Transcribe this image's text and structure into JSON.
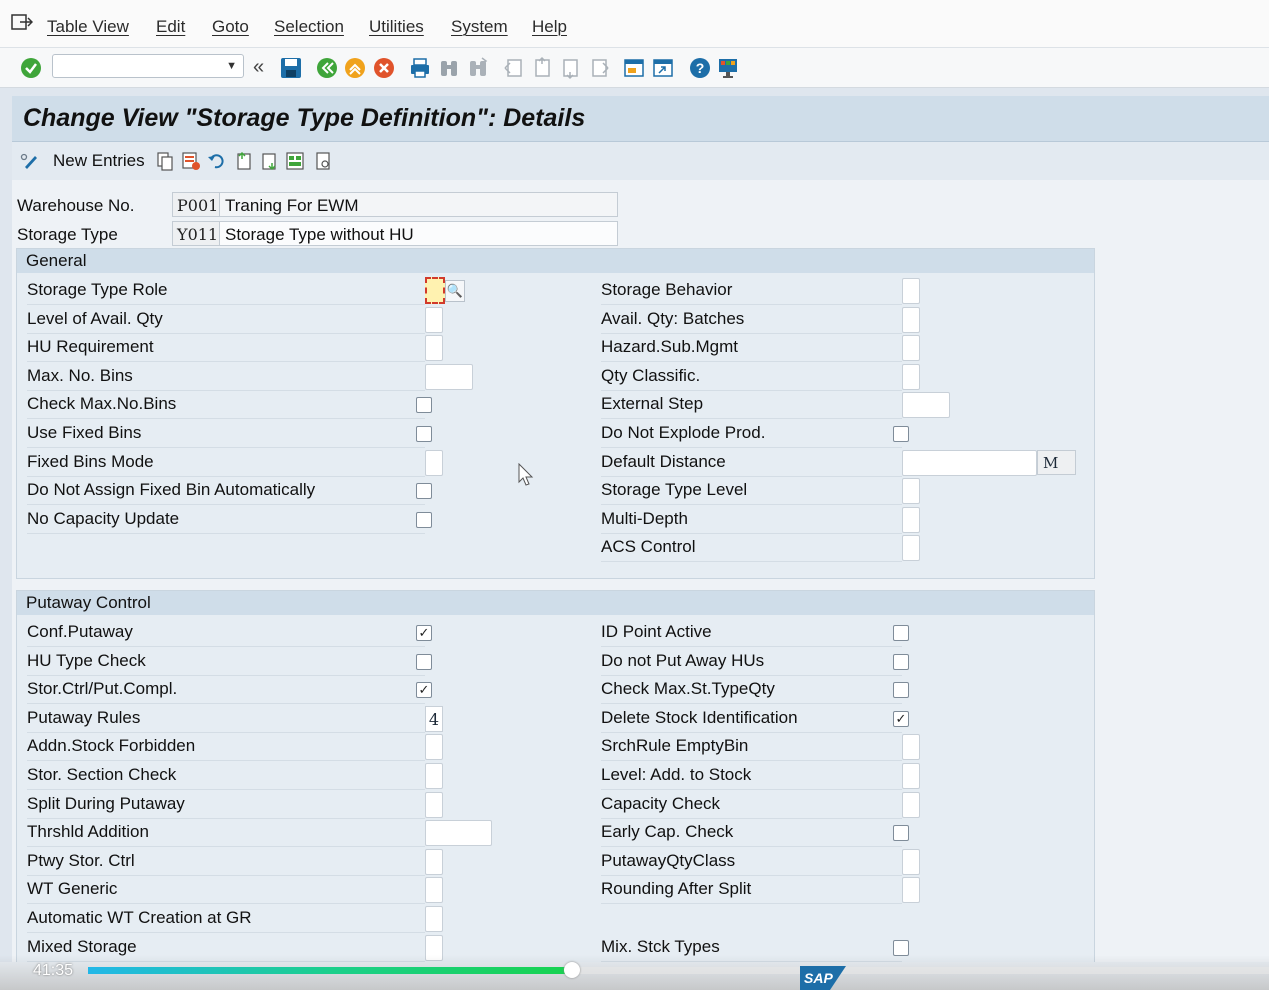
{
  "menubar": {
    "items": [
      "Table View",
      "Edit",
      "Goto",
      "Selection",
      "Utilities",
      "System",
      "Help"
    ]
  },
  "toolbar": {
    "command_field": "",
    "icons": [
      "enter-check-icon",
      "back-chevron-icon",
      "save-icon",
      "back-icon",
      "exit-icon",
      "cancel-icon",
      "print-icon",
      "find-icon",
      "find-next-icon",
      "first-page-icon",
      "previous-page-icon",
      "next-page-icon",
      "last-page-icon",
      "create-session-icon",
      "shortcut-icon",
      "help-icon",
      "customize-layout-icon"
    ]
  },
  "title": "Change View \"Storage Type Definition\": Details",
  "app_toolbar": {
    "new_entries": "New Entries"
  },
  "header": {
    "warehouse_label": "Warehouse No.",
    "warehouse_code": "P001",
    "warehouse_desc": "Traning For EWM",
    "storage_type_label": "Storage Type",
    "storage_type_code": "Y011",
    "storage_type_desc": "Storage Type without HU"
  },
  "general": {
    "title": "General",
    "left": [
      {
        "label": "Storage Type Role",
        "kind": "focus"
      },
      {
        "label": "Level of Avail. Qty",
        "kind": "box"
      },
      {
        "label": "HU Requirement",
        "kind": "box"
      },
      {
        "label": "Max. No. Bins",
        "kind": "wide"
      },
      {
        "label": "Check Max.No.Bins",
        "kind": "check",
        "checked": false
      },
      {
        "label": "Use Fixed Bins",
        "kind": "check",
        "checked": false
      },
      {
        "label": "Fixed Bins Mode",
        "kind": "box"
      },
      {
        "label": "Do Not Assign Fixed Bin Automatically",
        "kind": "check",
        "checked": false
      },
      {
        "label": "No Capacity Update",
        "kind": "check",
        "checked": false
      }
    ],
    "right": [
      {
        "label": "Storage Behavior",
        "kind": "box"
      },
      {
        "label": "Avail. Qty: Batches",
        "kind": "box"
      },
      {
        "label": "Hazard.Sub.Mgmt",
        "kind": "box"
      },
      {
        "label": "Qty Classific.",
        "kind": "box"
      },
      {
        "label": "External Step",
        "kind": "wide"
      },
      {
        "label": "Do Not Explode Prod.",
        "kind": "check",
        "checked": false
      },
      {
        "label": "Default Distance",
        "kind": "distance",
        "unit": "M"
      },
      {
        "label": "Storage Type Level",
        "kind": "box"
      },
      {
        "label": "Multi-Depth",
        "kind": "box"
      },
      {
        "label": "ACS Control",
        "kind": "box"
      }
    ]
  },
  "putaway": {
    "title": "Putaway Control",
    "left": [
      {
        "label": "Conf.Putaway",
        "kind": "check",
        "checked": true
      },
      {
        "label": "HU Type Check",
        "kind": "check",
        "checked": false
      },
      {
        "label": "Stor.Ctrl/Put.Compl.",
        "kind": "check",
        "checked": true
      },
      {
        "label": "Putaway Rules",
        "kind": "num",
        "value": "4"
      },
      {
        "label": "Addn.Stock Forbidden",
        "kind": "box"
      },
      {
        "label": "Stor. Section Check",
        "kind": "box"
      },
      {
        "label": "Split During Putaway",
        "kind": "box"
      },
      {
        "label": "Thrshld Addition",
        "kind": "wide"
      },
      {
        "label": "Ptwy Stor. Ctrl",
        "kind": "box"
      },
      {
        "label": "WT Generic",
        "kind": "box"
      },
      {
        "label": "Automatic WT Creation at GR",
        "kind": "box"
      },
      {
        "label": "Mixed Storage",
        "kind": "box"
      }
    ],
    "right": [
      {
        "label": "ID Point Active",
        "kind": "check",
        "checked": false
      },
      {
        "label": "Do not Put Away HUs",
        "kind": "check",
        "checked": false
      },
      {
        "label": "Check Max.St.TypeQty",
        "kind": "check",
        "checked": false
      },
      {
        "label": "Delete Stock Identification",
        "kind": "check",
        "checked": true
      },
      {
        "label": "SrchRule EmptyBin",
        "kind": "box"
      },
      {
        "label": "Level: Add. to Stock",
        "kind": "box"
      },
      {
        "label": "Capacity Check",
        "kind": "box"
      },
      {
        "label": "Early Cap. Check",
        "kind": "check",
        "checked": false
      },
      {
        "label": "PutawayQtyClass",
        "kind": "box"
      },
      {
        "label": "Rounding After Split",
        "kind": "box"
      },
      {
        "label": "",
        "kind": "none"
      },
      {
        "label": "Mix. Stck Types",
        "kind": "check",
        "checked": false
      }
    ]
  },
  "video": {
    "time": "41:35",
    "progress": 0.41,
    "logo_text": "SAP"
  }
}
